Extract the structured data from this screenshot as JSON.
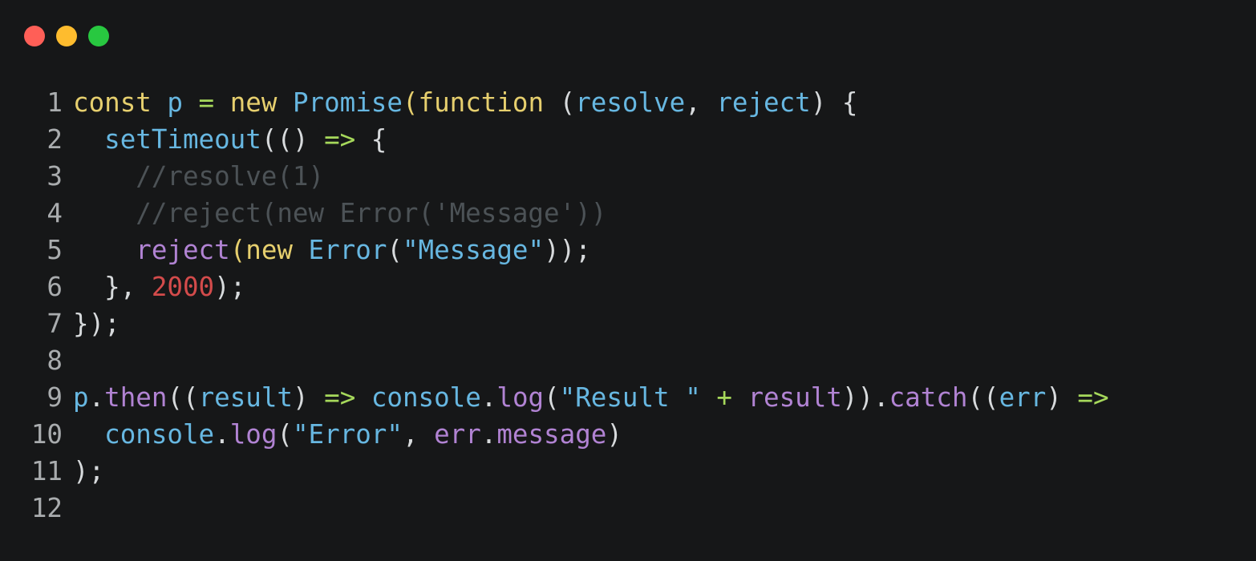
{
  "window": {
    "controls": [
      {
        "name": "close",
        "color": "#ff5f57"
      },
      {
        "name": "minimize",
        "color": "#febc2e"
      },
      {
        "name": "maximize",
        "color": "#28c840"
      }
    ]
  },
  "colors": {
    "plain": "#d7dadc",
    "keyword": "#e6cf6e",
    "identifier": "#67b7e1",
    "param": "#67b7e1",
    "operator": "#a6d85b",
    "comment": "#4c5256",
    "method": "#b183d3",
    "string": "#67b7e1",
    "number": "#d34b4b",
    "linenumber": "#a9acae"
  },
  "code": {
    "lines": [
      {
        "num": "1",
        "tokens": [
          {
            "t": "const ",
            "c": "keyword"
          },
          {
            "t": "p ",
            "c": "identifier"
          },
          {
            "t": "= ",
            "c": "operator"
          },
          {
            "t": "new ",
            "c": "keyword"
          },
          {
            "t": "Promise",
            "c": "identifier"
          },
          {
            "t": "(",
            "c": "keyword"
          },
          {
            "t": "function ",
            "c": "keyword"
          },
          {
            "t": "(",
            "c": "plain"
          },
          {
            "t": "resolve",
            "c": "param"
          },
          {
            "t": ", ",
            "c": "plain"
          },
          {
            "t": "reject",
            "c": "param"
          },
          {
            "t": ") {",
            "c": "plain"
          }
        ]
      },
      {
        "num": "2",
        "tokens": [
          {
            "t": "  ",
            "c": "plain"
          },
          {
            "t": "setTimeout",
            "c": "identifier"
          },
          {
            "t": "(() ",
            "c": "plain"
          },
          {
            "t": "=> ",
            "c": "operator"
          },
          {
            "t": "{",
            "c": "plain"
          }
        ]
      },
      {
        "num": "3",
        "tokens": [
          {
            "t": "    //resolve(1)",
            "c": "comment"
          }
        ]
      },
      {
        "num": "4",
        "tokens": [
          {
            "t": "    //reject(new Error('Message'))",
            "c": "comment"
          }
        ]
      },
      {
        "num": "5",
        "tokens": [
          {
            "t": "    ",
            "c": "plain"
          },
          {
            "t": "reject",
            "c": "method"
          },
          {
            "t": "(",
            "c": "keyword"
          },
          {
            "t": "new ",
            "c": "keyword"
          },
          {
            "t": "Error",
            "c": "identifier"
          },
          {
            "t": "(",
            "c": "plain"
          },
          {
            "t": "\"Message\"",
            "c": "string"
          },
          {
            "t": "));",
            "c": "plain"
          }
        ]
      },
      {
        "num": "6",
        "tokens": [
          {
            "t": "  }, ",
            "c": "plain"
          },
          {
            "t": "2000",
            "c": "number"
          },
          {
            "t": ");",
            "c": "plain"
          }
        ]
      },
      {
        "num": "7",
        "tokens": [
          {
            "t": "});",
            "c": "plain"
          }
        ]
      },
      {
        "num": "8",
        "tokens": []
      },
      {
        "num": "9",
        "tokens": [
          {
            "t": "p",
            "c": "identifier"
          },
          {
            "t": ".",
            "c": "plain"
          },
          {
            "t": "then",
            "c": "method"
          },
          {
            "t": "((",
            "c": "plain"
          },
          {
            "t": "result",
            "c": "param"
          },
          {
            "t": ") ",
            "c": "plain"
          },
          {
            "t": "=> ",
            "c": "operator"
          },
          {
            "t": "console",
            "c": "identifier"
          },
          {
            "t": ".",
            "c": "plain"
          },
          {
            "t": "log",
            "c": "method"
          },
          {
            "t": "(",
            "c": "plain"
          },
          {
            "t": "\"Result \" ",
            "c": "string"
          },
          {
            "t": "+ ",
            "c": "operator"
          },
          {
            "t": "result",
            "c": "method"
          },
          {
            "t": ")).",
            "c": "plain"
          },
          {
            "t": "catch",
            "c": "method"
          },
          {
            "t": "((",
            "c": "plain"
          },
          {
            "t": "err",
            "c": "param"
          },
          {
            "t": ") ",
            "c": "plain"
          },
          {
            "t": "=>",
            "c": "operator"
          }
        ]
      },
      {
        "num": "10",
        "tokens": [
          {
            "t": "  ",
            "c": "plain"
          },
          {
            "t": "console",
            "c": "identifier"
          },
          {
            "t": ".",
            "c": "plain"
          },
          {
            "t": "log",
            "c": "method"
          },
          {
            "t": "(",
            "c": "plain"
          },
          {
            "t": "\"Error\"",
            "c": "string"
          },
          {
            "t": ", ",
            "c": "plain"
          },
          {
            "t": "err",
            "c": "method"
          },
          {
            "t": ".",
            "c": "plain"
          },
          {
            "t": "message",
            "c": "method"
          },
          {
            "t": ")",
            "c": "plain"
          }
        ]
      },
      {
        "num": "11",
        "tokens": [
          {
            "t": ");",
            "c": "plain"
          }
        ]
      },
      {
        "num": "12",
        "tokens": []
      }
    ]
  }
}
